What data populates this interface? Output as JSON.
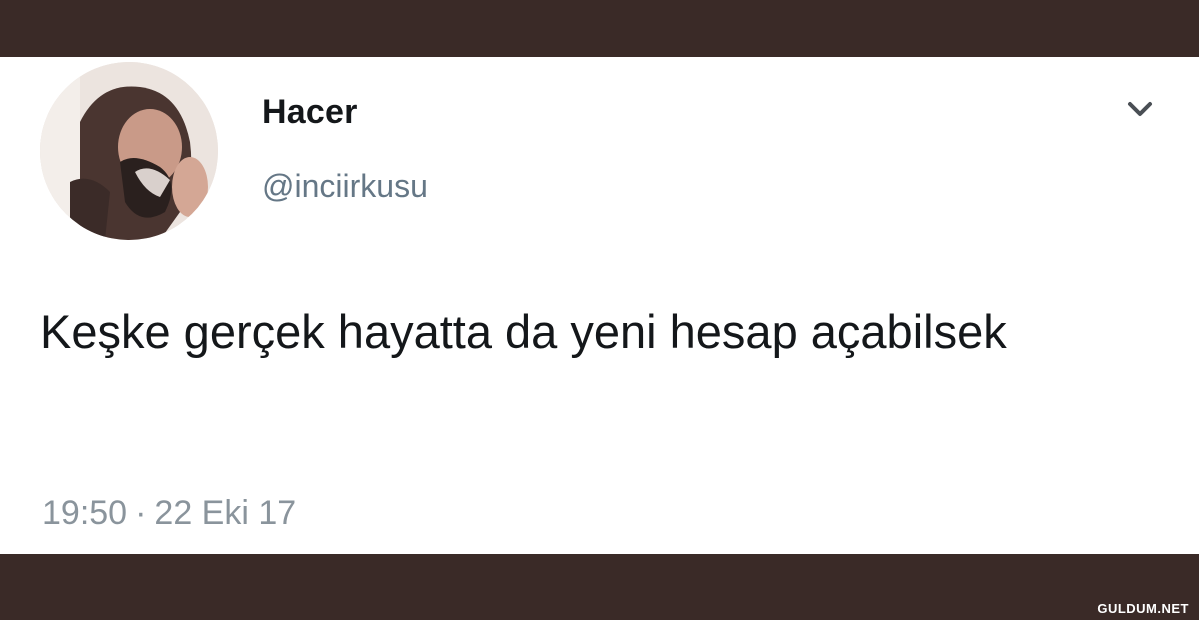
{
  "tweet": {
    "display_name": "Hacer",
    "handle": "@inciirkusu",
    "text": "Keşke gerçek hayatta da yeni hesap açabilsek",
    "time": "19:50",
    "separator": "·",
    "date": "22 Eki 17"
  },
  "icons": {
    "menu": "chevron-down-icon",
    "avatar": "profile-photo"
  },
  "watermark": "GULDUM.NET",
  "colors": {
    "frame": "#3a2a27",
    "card": "#ffffff",
    "text": "#14171a",
    "secondary": "#657786",
    "meta": "#8a949c"
  }
}
